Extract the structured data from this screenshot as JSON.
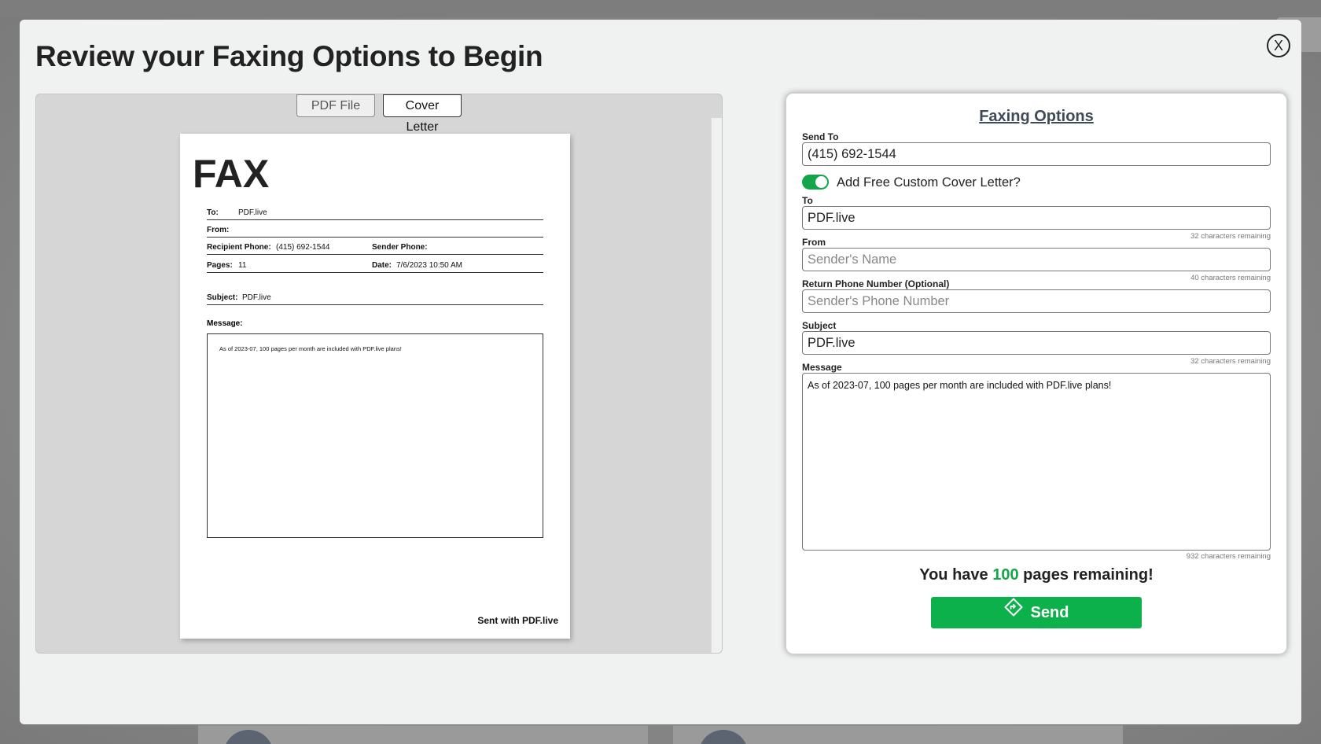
{
  "modal": {
    "title": "Review your Faxing Options to Begin",
    "close_label": "X"
  },
  "preview": {
    "tabs": [
      {
        "label": "PDF File",
        "active": false
      },
      {
        "label": "Cover Letter",
        "active": true
      }
    ],
    "cover": {
      "heading": "FAX",
      "to_label": "To:",
      "to_value": "PDF.live",
      "from_label": "From:",
      "from_value": "",
      "recipient_phone_label": "Recipient Phone:",
      "recipient_phone_value": "(415) 692-1544",
      "sender_phone_label": "Sender Phone:",
      "sender_phone_value": "",
      "pages_label": "Pages:",
      "pages_value": "11",
      "date_label": "Date:",
      "date_value": "7/6/2023 10:50 AM",
      "subject_label": "Subject:",
      "subject_value": "PDF.live",
      "message_label": "Message:",
      "message_value": "As of 2023-07, 100 pages per month are included with PDF.live plans!",
      "footer": "Sent with PDF.live"
    }
  },
  "options": {
    "title": "Faxing Options",
    "send_to": {
      "label": "Send To",
      "value": "(415) 692-1544"
    },
    "cover_toggle": {
      "label": "Add Free Custom Cover Letter?",
      "on": true
    },
    "to": {
      "label": "To",
      "value": "PDF.live",
      "counter": "32 characters remaining"
    },
    "from": {
      "label": "From",
      "value": "",
      "placeholder": "Sender's Name",
      "counter": "40 characters remaining"
    },
    "return_phone": {
      "label": "Return Phone Number (Optional)",
      "value": "",
      "placeholder": "Sender's Phone Number"
    },
    "subject": {
      "label": "Subject",
      "value": "PDF.live",
      "counter": "32 characters remaining"
    },
    "message": {
      "label": "Message",
      "value": "As of 2023-07, 100 pages per month are included with PDF.live plans!",
      "counter": "932 characters remaining"
    },
    "remaining": {
      "prefix": "You have",
      "count": "100",
      "suffix": "pages remaining!"
    },
    "send_label": "Send"
  },
  "colors": {
    "accent_green": "#0db14b",
    "title_slate": "#3f4a57"
  },
  "icons": {
    "close": "close-icon",
    "send": "send-diamond-icon"
  }
}
